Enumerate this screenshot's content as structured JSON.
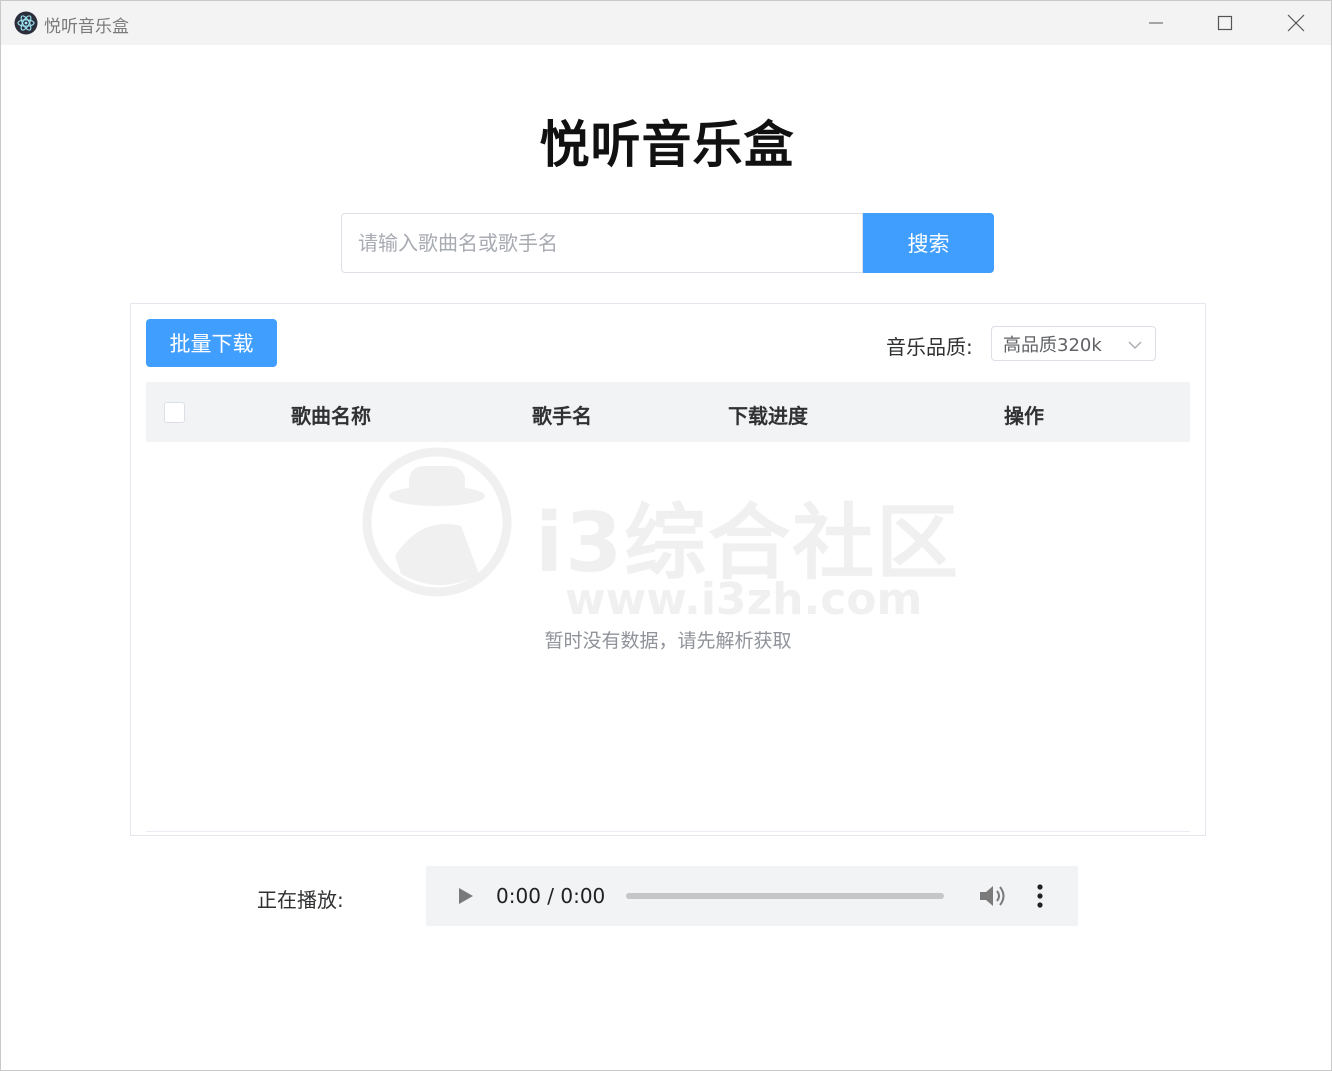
{
  "window": {
    "title": "悦听音乐盒",
    "app_icon": "electron-icon",
    "controls": [
      "minimize-icon",
      "maximize-icon",
      "close-icon"
    ]
  },
  "header": {
    "title": "悦听音乐盒"
  },
  "search": {
    "placeholder": "请输入歌曲名或歌手名",
    "value": "",
    "button_label": "搜索"
  },
  "toolbar": {
    "batch_download_label": "批量下载",
    "quality_label": "音乐品质:",
    "quality_selected": "高品质320k"
  },
  "table": {
    "columns": [
      "歌曲名称",
      "歌手名",
      "下载进度",
      "操作"
    ],
    "rows": [],
    "empty_text": "暂时没有数据，请先解析获取"
  },
  "watermark": {
    "text": "i3综合社区",
    "url": "www.i3zh.com"
  },
  "player": {
    "label": "正在播放:",
    "time": "0:00 / 0:00",
    "progress": 0
  },
  "colors": {
    "primary": "#409eff",
    "header_bg": "#f2f3f5",
    "player_bg": "#f1f3f4",
    "empty_text": "#909399"
  }
}
